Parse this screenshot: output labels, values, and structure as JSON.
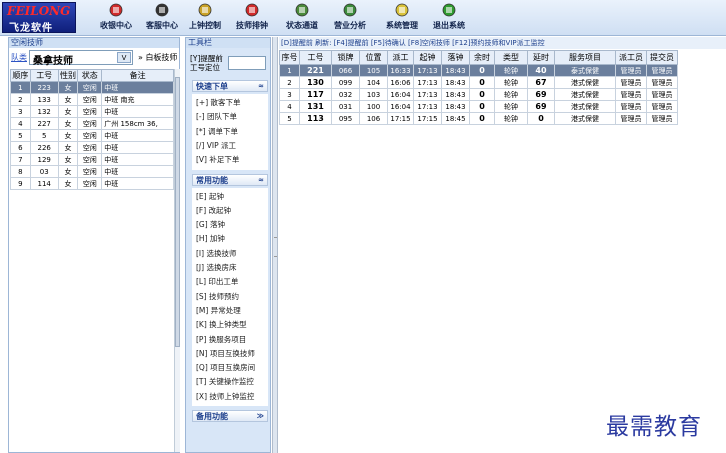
{
  "toolbar": {
    "logo_en": "FEILONG",
    "logo_cn": "飞龙软件",
    "buttons": [
      {
        "label": "收银中心",
        "icon": "cashier-icon",
        "color": "#d02a2a"
      },
      {
        "label": "客服中心",
        "icon": "customer-service-icon",
        "color": "#333333"
      },
      {
        "label": "上钟控制",
        "icon": "clock-control-icon",
        "color": "#c9a227"
      },
      {
        "label": "技师排钟",
        "icon": "technician-schedule-icon",
        "color": "#d02a2a"
      },
      {
        "label": "状态通道",
        "icon": "status-channel-icon",
        "color": "#4a8a3a"
      },
      {
        "label": "营业分析",
        "icon": "business-analysis-icon",
        "color": "#3a8a3a"
      },
      {
        "label": "系统管理",
        "icon": "system-manage-icon",
        "color": "#d9c23a"
      },
      {
        "label": "退出系统",
        "icon": "exit-icon",
        "color": "#2e9a2e"
      }
    ]
  },
  "left_panel": {
    "title": "空闲技师",
    "queue_link": "队类",
    "queue_value": "桑拿技师",
    "queue_arrow": "V",
    "white_board": "» 白板技师",
    "columns": [
      "顺序",
      "工号",
      "性别",
      "状态",
      "备注"
    ],
    "rows": [
      [
        "1",
        "223",
        "女",
        "空闲",
        "中班"
      ],
      [
        "2",
        "133",
        "女",
        "空闲",
        "中班 南充"
      ],
      [
        "3",
        "132",
        "女",
        "空闲",
        "中班"
      ],
      [
        "4",
        "227",
        "女",
        "空闲",
        "广州 158cm 36,"
      ],
      [
        "5",
        "5",
        "女",
        "空闲",
        "中班"
      ],
      [
        "6",
        "226",
        "女",
        "空闲",
        "中班"
      ],
      [
        "7",
        "129",
        "女",
        "空闲",
        "中班"
      ],
      [
        "8",
        "03",
        "女",
        "空闲",
        "中班"
      ],
      [
        "9",
        "114",
        "女",
        "空闲",
        "中班"
      ]
    ],
    "selected_row": 0
  },
  "tools_panel": {
    "title": "工具栏",
    "locate_line1": "[Y]提醒前",
    "locate_line2": "工号定位",
    "sections": [
      {
        "title": "快速下单",
        "chevron": "≈",
        "items": [
          "[+] 散客下单",
          "[-] 团队下单",
          "[*] 调单下单",
          "[/] VIP 派工",
          "[V] 补足下单"
        ]
      },
      {
        "title": "常用功能",
        "chevron": "≈",
        "items": [
          "[E] 起钟",
          "[F] 改起钟",
          "[G] 落钟",
          "[H] 加钟",
          "[I] 选换技师",
          "[J] 选换房床",
          "[L] 印出工单",
          "[S] 技师预约",
          "[M] 异常处理",
          "[K] 换上钟类型",
          "[P] 换服务项目",
          "[N] 项目互换技师",
          "[Q] 项目互换房间",
          "[T] 关键操作监控",
          "[X] 技师上钟监控"
        ]
      },
      {
        "title": "备用功能",
        "chevron": "≫",
        "items": []
      }
    ]
  },
  "right_panel": {
    "shortcut_bar": "[D]提醒前   刷新: [F4]提醒前 [F5]待确认 [F8]空闲技师 [F12]预约技师和VIP派工监控",
    "columns": [
      "序号",
      "工号",
      "锁牌",
      "位置",
      "派工",
      "起钟",
      "落钟",
      "余时",
      "类型",
      "延时",
      "服务项目",
      "派工员",
      "提交员"
    ],
    "rows": [
      [
        "1",
        "221",
        "066",
        "105",
        "16:33",
        "17:13",
        "18:43",
        "0",
        "轮钟",
        "40",
        "泰式保健",
        "管理员",
        "管理员"
      ],
      [
        "2",
        "130",
        "099",
        "104",
        "16:06",
        "17:13",
        "18:43",
        "0",
        "轮钟",
        "67",
        "港式保健",
        "管理员",
        "管理员"
      ],
      [
        "3",
        "117",
        "032",
        "103",
        "16:04",
        "17:13",
        "18:43",
        "0",
        "轮钟",
        "69",
        "港式保健",
        "管理员",
        "管理员"
      ],
      [
        "4",
        "131",
        "031",
        "100",
        "16:04",
        "17:13",
        "18:43",
        "0",
        "轮钟",
        "69",
        "港式保健",
        "管理员",
        "管理员"
      ],
      [
        "5",
        "113",
        "095",
        "106",
        "17:15",
        "17:15",
        "18:45",
        "0",
        "轮钟",
        "0",
        "港式保健",
        "管理员",
        "管理员"
      ]
    ],
    "selected_row": 0
  },
  "watermark": "最需教育"
}
